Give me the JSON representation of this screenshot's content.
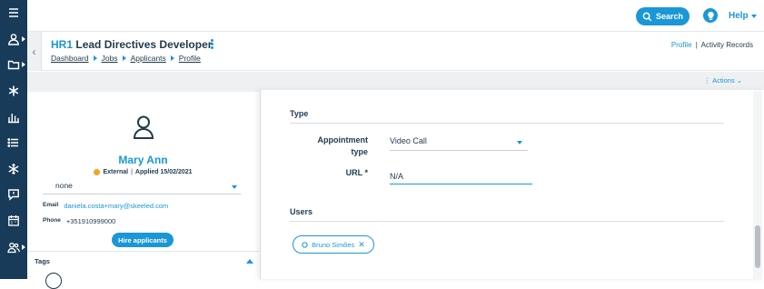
{
  "rail": {
    "items": [
      {
        "icon": "hamburger-menu-icon"
      },
      {
        "icon": "user-icon"
      },
      {
        "icon": "folder-icon"
      },
      {
        "icon": "asterisk-icon"
      },
      {
        "icon": "bar-chart-icon"
      },
      {
        "icon": "list-icon"
      },
      {
        "icon": "snowflake-icon"
      },
      {
        "icon": "message-icon"
      },
      {
        "icon": "calendar-icon"
      },
      {
        "icon": "users-icon"
      }
    ]
  },
  "topbar": {
    "search_label": "Search",
    "help_label": "Help"
  },
  "header": {
    "job_code": "HR1",
    "job_title": "Lead Directives Developer",
    "breadcrumb": [
      "Dashboard",
      "Jobs",
      "Applicants",
      "Profile"
    ],
    "link_profile": "Profile",
    "link_separator": "|",
    "link_activity": "Activity Records"
  },
  "actions_label": "Actions",
  "candidate": {
    "name": "Mary Ann",
    "source": "External",
    "meta_separator": "|",
    "applied": "Applied 15/02/2021",
    "status_value": "none",
    "email_label": "Email",
    "email": "daniela.costa+mary@skeeled.com",
    "phone_label": "Phone",
    "phone": "+351910999000",
    "hire_button": "Hire applicants",
    "tags_label": "Tags"
  },
  "form": {
    "type_section": "Type",
    "appointment_label_line1": "Appointment",
    "appointment_label_line2": "type",
    "appointment_value": "Video Call",
    "url_label": "URL *",
    "url_value": "N/A",
    "users_section": "Users",
    "user_chip_name": "Bruno Simões"
  },
  "colors": {
    "accent": "#1a97d6",
    "rail": "#173b59",
    "text": "#1f3a4d",
    "external_dot": "#f3a623"
  }
}
